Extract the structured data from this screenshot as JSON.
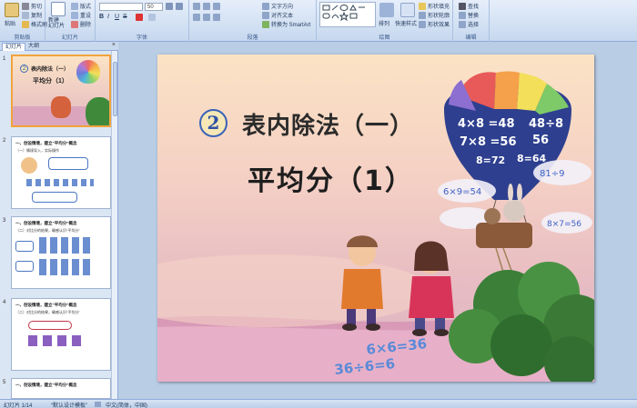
{
  "ribbon": {
    "clipboard": {
      "paste": "粘贴",
      "cut": "剪切",
      "copy": "复制",
      "format_painter": "格式刷",
      "label": "剪贴板"
    },
    "slides": {
      "new_slide": "新建\n幻灯片",
      "layout": "版式",
      "reset": "重设",
      "delete": "删除",
      "label": "幻灯片"
    },
    "font": {
      "font_name": "",
      "font_size": "50",
      "label": "字体"
    },
    "paragraph": {
      "text_direction": "文字方向",
      "align_text": "对齐文本",
      "smartart": "转换为 SmartArt",
      "label": "段落"
    },
    "drawing": {
      "arrange": "排列",
      "quick_styles": "快速样式",
      "shape_fill": "形状填充",
      "shape_outline": "形状轮廓",
      "shape_effects": "形状效果",
      "label": "绘图"
    },
    "editing": {
      "find": "查找",
      "replace": "替换",
      "select": "选择",
      "label": "编辑"
    }
  },
  "panel": {
    "tab_slides": "幻灯片",
    "tab_outline": "大纲",
    "close": "×"
  },
  "thumbnails": [
    {
      "num": "1",
      "heading": "表内除法（一）",
      "sub": "平均分（1）",
      "badge": "2"
    },
    {
      "num": "2",
      "heading": "一、创设情境，建立“平均分”概念",
      "sub": "（一）情境导入，实际操作"
    },
    {
      "num": "3",
      "heading": "一、创设情境，建立“平均分”概念",
      "sub": "（二）对比分的结果，确感认识“平均分”"
    },
    {
      "num": "4",
      "heading": "一、创设情境，建立“平均分”概念",
      "sub": "（二）对比分的结果，确感认识“平均分”"
    },
    {
      "num": "5",
      "heading": "一、创设情境，建立“平均分”概念",
      "sub": ""
    }
  ],
  "slide": {
    "number_badge": "2",
    "title": "表内除法（一）",
    "subtitle": "平均分（1）",
    "balloon_formulas": [
      "4×8 =48",
      "48÷8",
      "56",
      "7×8 =56",
      "8=72",
      "8=64",
      "6×9=54",
      "81÷9",
      "8×7=56"
    ],
    "ground_formulas": [
      "6×6=36",
      "36÷6=6"
    ]
  },
  "status": {
    "slide_counter": "幻灯片 1/14",
    "theme": "“默认设计模板”",
    "language": "中文(简体，中国)"
  },
  "colors": {
    "ribbon_bg": "#d3e1f3",
    "panel_bg": "#dbe6f4",
    "selected_border": "#f1a33c",
    "title_badge_border": "#3a63b8"
  }
}
